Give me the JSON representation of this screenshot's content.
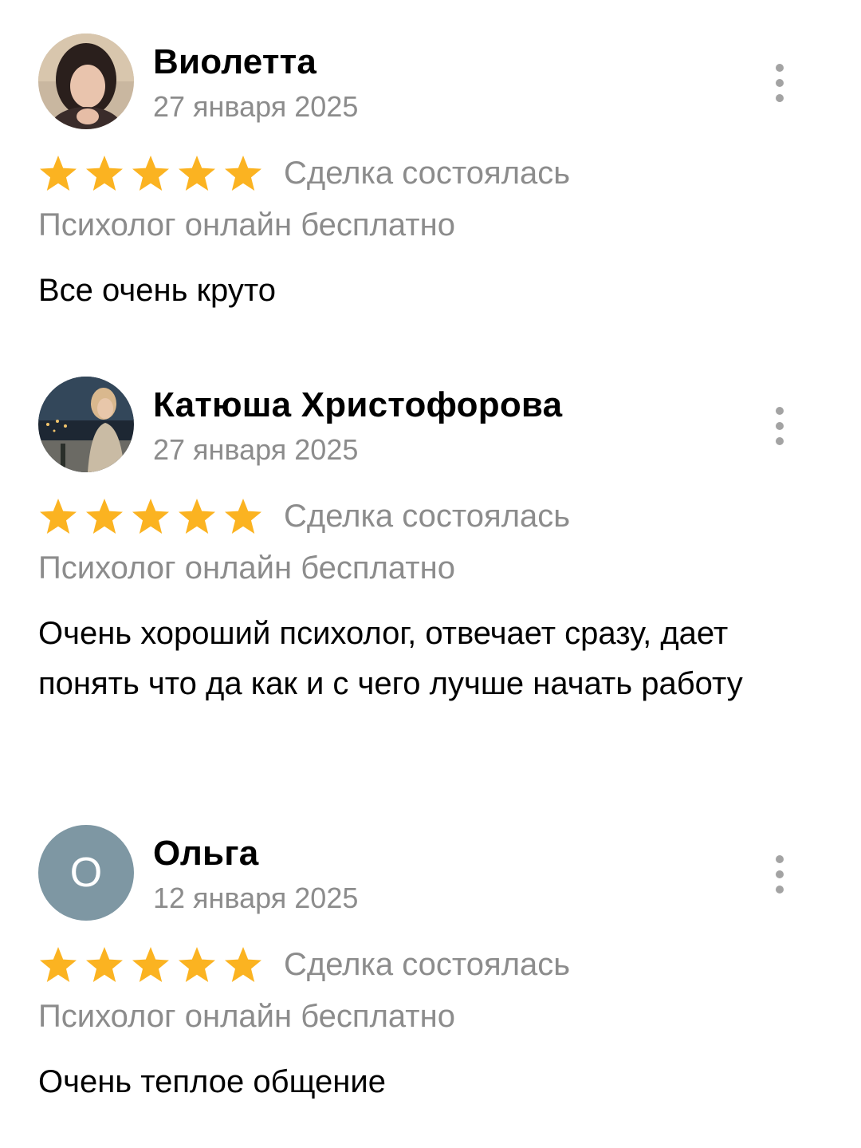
{
  "colors": {
    "star": "#FBB321",
    "secondary_text": "#8c8c8c",
    "primary_text": "#000000",
    "letter_avatar_bg": "#7e97a3",
    "menu_dots": "#a3a3a3"
  },
  "reviews": [
    {
      "name": "Виолетта",
      "date": "27 января 2025",
      "avatar": {
        "type": "photo"
      },
      "rating": 5,
      "deal_status": "Сделка состоялась",
      "service": "Психолог онлайн бесплатно",
      "text": "Все очень круто"
    },
    {
      "name": "Катюша Христофорова",
      "date": "27 января 2025",
      "avatar": {
        "type": "photo"
      },
      "rating": 5,
      "deal_status": "Сделка состоялась",
      "service": "Психолог онлайн бесплатно",
      "text": "Очень хороший психолог, отвечает сразу, дает понять что да как и с чего лучше начать работу"
    },
    {
      "name": "Ольга",
      "date": "12 января 2025",
      "avatar": {
        "type": "letter",
        "letter": "О"
      },
      "rating": 5,
      "deal_status": "Сделка состоялась",
      "service": "Психолог онлайн бесплатно",
      "text": "Очень теплое общение"
    }
  ],
  "icons": {
    "star": "star-icon",
    "menu": "more-vertical-icon"
  }
}
